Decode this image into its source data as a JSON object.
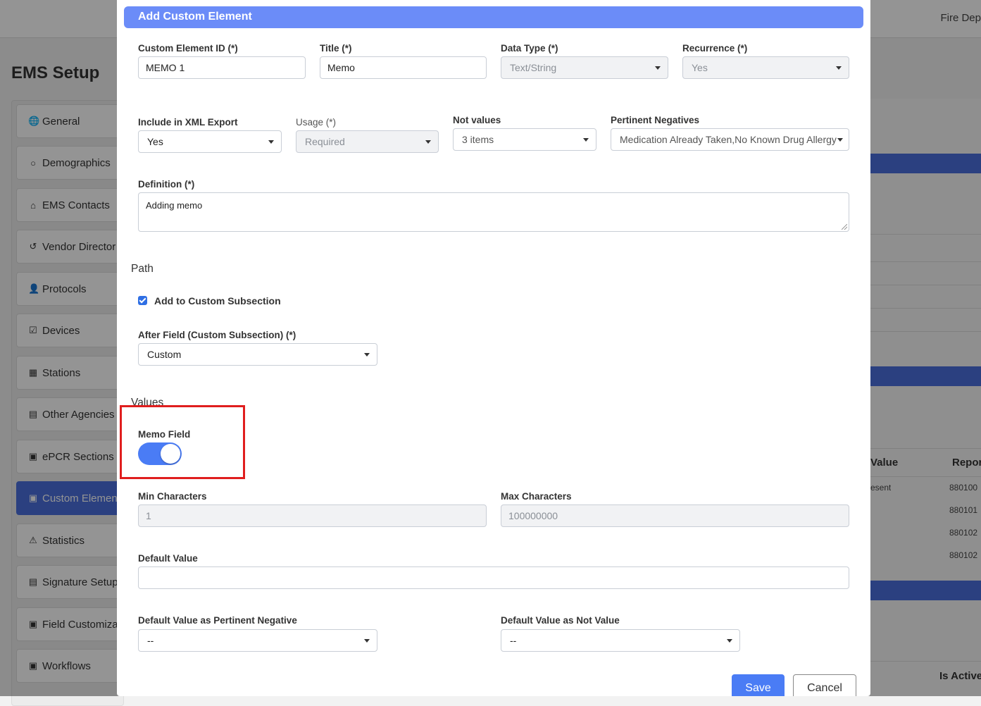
{
  "background": {
    "org_label": "Fire Dep",
    "page_title": "EMS Setup",
    "nav_items": [
      {
        "label": "General",
        "icon": "globe-icon",
        "glyph": "🌐"
      },
      {
        "label": "Demographics",
        "icon": "circle-icon",
        "glyph": "○"
      },
      {
        "label": "EMS Contacts",
        "icon": "home-icon",
        "glyph": "⌂"
      },
      {
        "label": "Vendor Director",
        "icon": "history-icon",
        "glyph": "↺"
      },
      {
        "label": "Protocols",
        "icon": "user-icon",
        "glyph": "👤"
      },
      {
        "label": "Devices",
        "icon": "check-square-icon",
        "glyph": "☑"
      },
      {
        "label": "Stations",
        "icon": "building-icon",
        "glyph": "▦"
      },
      {
        "label": "Other Agencies A",
        "icon": "file-icon",
        "glyph": "▤"
      },
      {
        "label": "ePCR Sections",
        "icon": "calendar-icon",
        "glyph": "▣"
      },
      {
        "label": "Custom Element",
        "icon": "calendar-icon",
        "glyph": "▣"
      },
      {
        "label": "Statistics",
        "icon": "warning-icon",
        "glyph": "⚠"
      },
      {
        "label": "Signature Setup",
        "icon": "file-icon",
        "glyph": "▤"
      },
      {
        "label": "Field Customiza",
        "icon": "calendar-icon",
        "glyph": "▣"
      },
      {
        "label": "Workflows",
        "icon": "calendar-icon",
        "glyph": "▣"
      }
    ],
    "table": {
      "headers": [
        "Value",
        "Repor"
      ],
      "cells": [
        "esent",
        "880100",
        "880101",
        "880102",
        "880102"
      ],
      "footer_header": "Is Active"
    }
  },
  "modal": {
    "title": "Add Custom Element",
    "custom_element_id": {
      "label": "Custom Element ID (*)",
      "value": "MEMO 1"
    },
    "title_field": {
      "label": "Title (*)",
      "value": "Memo"
    },
    "data_type": {
      "label": "Data Type (*)",
      "value": "Text/String"
    },
    "recurrence": {
      "label": "Recurrence (*)",
      "value": "Yes"
    },
    "include_xml": {
      "label": "Include in XML Export",
      "value": "Yes"
    },
    "usage": {
      "label": "Usage (*)",
      "value": "Required"
    },
    "not_values": {
      "label": "Not values",
      "value": "3 items"
    },
    "pertinent_negatives": {
      "label": "Pertinent Negatives",
      "value": "Medication Already Taken,No Known Drug Allergy"
    },
    "definition": {
      "label": "Definition (*)",
      "value": "Adding memo"
    },
    "path_title": "Path",
    "add_to_custom_subsection": {
      "label": "Add to Custom Subsection",
      "checked": true
    },
    "after_field": {
      "label": "After Field (Custom Subsection) (*)",
      "value": "Custom"
    },
    "values_title": "Values",
    "memo_field": {
      "label": "Memo Field",
      "on": true
    },
    "min_characters": {
      "label": "Min Characters",
      "value": "1"
    },
    "max_characters": {
      "label": "Max Characters",
      "value": "100000000"
    },
    "default_value": {
      "label": "Default Value",
      "value": ""
    },
    "default_pertinent_negative": {
      "label": "Default Value as Pertinent Negative",
      "value": "--"
    },
    "default_not_value": {
      "label": "Default Value as Not Value",
      "value": "--"
    },
    "save_label": "Save",
    "cancel_label": "Cancel"
  },
  "colors": {
    "header": "#6b8cf8",
    "primary": "#4a7cf5",
    "highlight": "#e01e1e",
    "nav_active": "#4a6fdc"
  }
}
